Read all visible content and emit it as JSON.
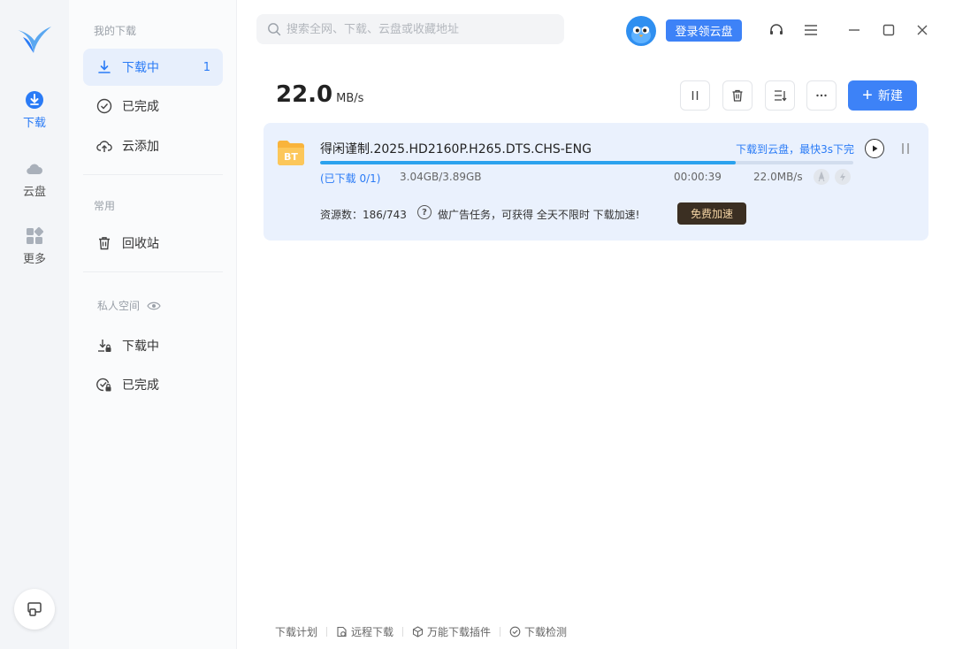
{
  "rail": {
    "items": [
      {
        "label": "下载",
        "icon": "download-circle-icon",
        "active": true
      },
      {
        "label": "云盘",
        "icon": "cloud-icon",
        "active": false
      },
      {
        "label": "更多",
        "icon": "apps-grid-icon",
        "active": false
      }
    ]
  },
  "sidebar": {
    "my_downloads_title": "我的下载",
    "downloading": {
      "label": "下载中",
      "count": "1"
    },
    "completed": {
      "label": "已完成"
    },
    "cloud_add": {
      "label": "云添加"
    },
    "common_title": "常用",
    "recycle": {
      "label": "回收站"
    },
    "private_title": "私人空间",
    "private_downloading": {
      "label": "下载中"
    },
    "private_completed": {
      "label": "已完成"
    }
  },
  "topbar": {
    "search_placeholder": "搜索全网、下载、云盘或收藏地址",
    "login_label": "登录领云盘"
  },
  "toolbar": {
    "speed_value": "22.0",
    "speed_unit": "MB/s",
    "new_label": "新建"
  },
  "task": {
    "name": "得闲谨制.2025.HD2160P.H265.DTS.CHS-ENG",
    "cloud_link": "下载到云盘，最快3s下完",
    "progress_fraction": 0.78,
    "downloaded_files": "(已下载 0/1)",
    "size": "3.04GB/3.89GB",
    "elapsed": "00:00:39",
    "speed": "22.0MB/s",
    "sources": "资源数：186/743",
    "promo": "做广告任务，可获得 全天不限时 下载加速!",
    "free_boost_label": "免费加速"
  },
  "footer": {
    "items": [
      "下载计划",
      "远程下载",
      "万能下载插件",
      "下载检测"
    ]
  },
  "colors": {
    "accent": "#3d82f7",
    "card_bg": "#eaf1fd",
    "progress": "#2ba2ee",
    "promo_button": "#3b2f22"
  }
}
